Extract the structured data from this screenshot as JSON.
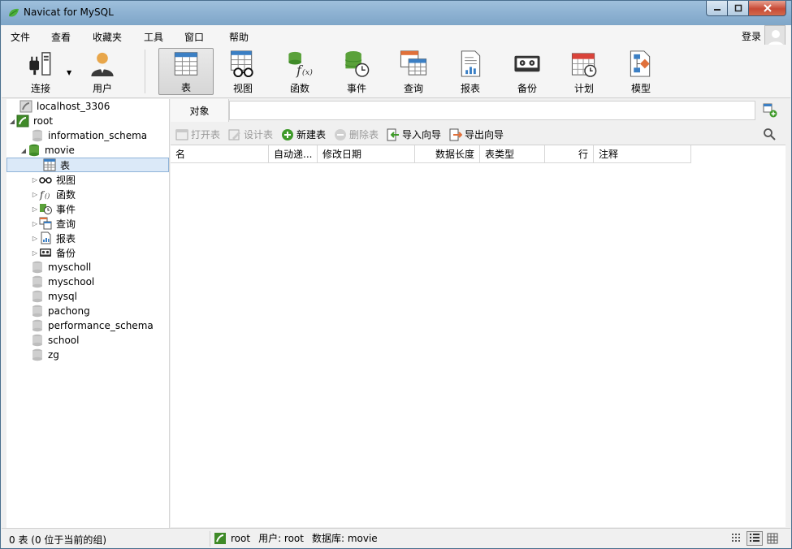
{
  "window": {
    "title": "Navicat for MySQL"
  },
  "menu": {
    "items": [
      "文件",
      "查看",
      "收藏夹",
      "工具",
      "窗口",
      "帮助"
    ],
    "login": "登录"
  },
  "toolbar": {
    "buttons": [
      {
        "label": "连接",
        "icon": "connect-icon"
      },
      {
        "label": "用户",
        "icon": "user-icon"
      },
      {
        "label": "表",
        "icon": "table-icon"
      },
      {
        "label": "视图",
        "icon": "view-icon"
      },
      {
        "label": "函数",
        "icon": "function-icon"
      },
      {
        "label": "事件",
        "icon": "event-icon"
      },
      {
        "label": "查询",
        "icon": "query-icon"
      },
      {
        "label": "报表",
        "icon": "report-icon"
      },
      {
        "label": "备份",
        "icon": "backup-icon"
      },
      {
        "label": "计划",
        "icon": "schedule-icon"
      },
      {
        "label": "模型",
        "icon": "model-icon"
      }
    ],
    "active": "表"
  },
  "tree": {
    "connections": [
      {
        "label": "localhost_3306"
      },
      {
        "label": "root"
      }
    ],
    "databases": [
      "information_schema",
      "movie",
      "myscholl",
      "myschool",
      "mysql",
      "pachong",
      "performance_schema",
      "school",
      "zg"
    ],
    "movie_children": [
      "表",
      "视图",
      "函数",
      "事件",
      "查询",
      "报表",
      "备份"
    ]
  },
  "objects": {
    "tab_label": "对象",
    "actions": [
      {
        "label": "打开表",
        "enabled": false
      },
      {
        "label": "设计表",
        "enabled": false
      },
      {
        "label": "新建表",
        "enabled": true
      },
      {
        "label": "删除表",
        "enabled": false
      },
      {
        "label": "导入向导",
        "enabled": true
      },
      {
        "label": "导出向导",
        "enabled": true
      }
    ],
    "columns": [
      "名",
      "自动递...",
      "修改日期",
      "数据长度",
      "表类型",
      "行",
      "注释"
    ]
  },
  "status": {
    "left": "0 表 (0 位于当前的组)",
    "connection": "root",
    "user": "用户: root",
    "database": "数据库: movie"
  },
  "colors": {
    "titlebar": "#8fb3d3",
    "selection": "#dbe9f8",
    "db_green": "#5aa13a"
  }
}
